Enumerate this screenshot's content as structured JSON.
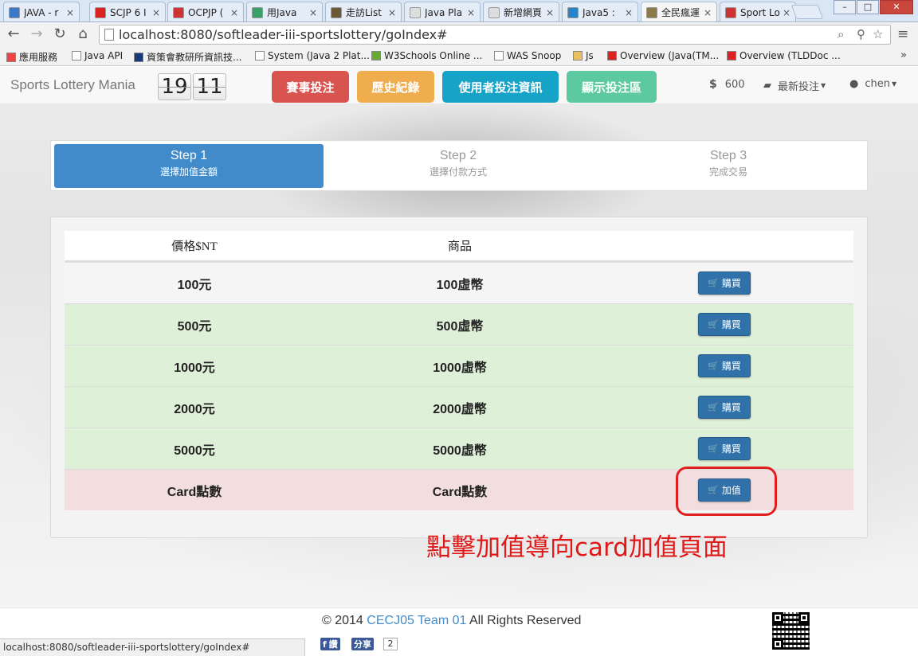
{
  "browser": {
    "tabs": [
      {
        "title": "JAVA - r",
        "favicon_color": "#3a78c8"
      },
      {
        "title": "SCJP 6 I",
        "favicon_color": "#d22"
      },
      {
        "title": "OCPJP (",
        "favicon_color": "#c33"
      },
      {
        "title": "用Java",
        "favicon_color": "#3aa06a"
      },
      {
        "title": "走訪List",
        "favicon_color": "#6a5a3a"
      },
      {
        "title": "Java Pla",
        "favicon_color": "#ddd"
      },
      {
        "title": "新增網頁",
        "favicon_color": "#ddd"
      },
      {
        "title": "Java5 :",
        "favicon_color": "#2a82c8"
      },
      {
        "title": "全民瘋運",
        "favicon_color": "#8a7a4a"
      },
      {
        "title": "Sport Lo",
        "favicon_color": "#c33"
      }
    ],
    "active_tab_index": 8,
    "close_glyph": "×",
    "url": "localhost:8080/softleader-iii-sportslottery/goIndex#",
    "bookmarks": [
      {
        "label": "應用服務",
        "icon": "apps-grid-icon",
        "color": "#e44"
      },
      {
        "label": "Java API",
        "icon": "page-icon",
        "color": "#fff"
      },
      {
        "label": "資策會教研所資訊技...",
        "icon": "iii-logo-icon",
        "color": "#1a3a7a"
      },
      {
        "label": "System (Java 2 Plat...",
        "icon": "page-icon",
        "color": "#fff"
      },
      {
        "label": "W3Schools Online ...",
        "icon": "w3-icon",
        "color": "#6a3"
      },
      {
        "label": "WAS Snoop",
        "icon": "page-icon",
        "color": "#fff"
      },
      {
        "label": "Js",
        "icon": "folder-icon",
        "color": "#e8c060"
      },
      {
        "label": "Overview (Java(TM...",
        "icon": "oracle-icon",
        "color": "#d22"
      },
      {
        "label": "Overview (TLDDoc ...",
        "icon": "oracle-icon",
        "color": "#d22"
      }
    ],
    "bookmarks_more": "»",
    "status_url": "localhost:8080/softleader-iii-sportslottery/goIndex#"
  },
  "navbar": {
    "brand": "Sports Lottery Mania",
    "clock": {
      "hours": "19",
      "minutes": "11"
    },
    "buttons": [
      {
        "label": "賽事投注",
        "color": "#d9534f"
      },
      {
        "label": "歷史紀錄",
        "color": "#f0ad4e"
      },
      {
        "label": "使用者投注資訊",
        "color": "#17a2c8"
      },
      {
        "label": "顯示投注區",
        "color": "#5cc9a0"
      }
    ],
    "balance_symbol": "$",
    "balance": "600",
    "latest_bets_label": "最新投注",
    "user_label": "chen"
  },
  "steps": [
    {
      "title": "Step 1",
      "subtitle": "選擇加值金額"
    },
    {
      "title": "Step 2",
      "subtitle": "選擇付款方式"
    },
    {
      "title": "Step 3",
      "subtitle": "完成交易"
    }
  ],
  "active_step_index": 0,
  "table": {
    "headers": [
      "價格$NT",
      "商品"
    ],
    "rows": [
      {
        "price": "100元",
        "product": "100虛幣",
        "button": "購買",
        "bg": "#f5f5f5"
      },
      {
        "price": "500元",
        "product": "500虛幣",
        "button": "購買",
        "bg": "#dff0d8"
      },
      {
        "price": "1000元",
        "product": "1000虛幣",
        "button": "購買",
        "bg": "#dff0d8"
      },
      {
        "price": "2000元",
        "product": "2000虛幣",
        "button": "購買",
        "bg": "#dff0d8"
      },
      {
        "price": "5000元",
        "product": "5000虛幣",
        "button": "購買",
        "bg": "#dff0d8"
      },
      {
        "price": "Card點數",
        "product": "Card點數",
        "button": "加值",
        "bg": "#f2dede"
      }
    ]
  },
  "annotation": "點擊加值導向card加值頁面",
  "footer": {
    "copyright_prefix": "© 2014 ",
    "team": "CECJ05 Team 01",
    "copyright_suffix": " All Rights Reserved",
    "fb_like": "讚",
    "fb_share": "分享",
    "fb_count": "2"
  }
}
